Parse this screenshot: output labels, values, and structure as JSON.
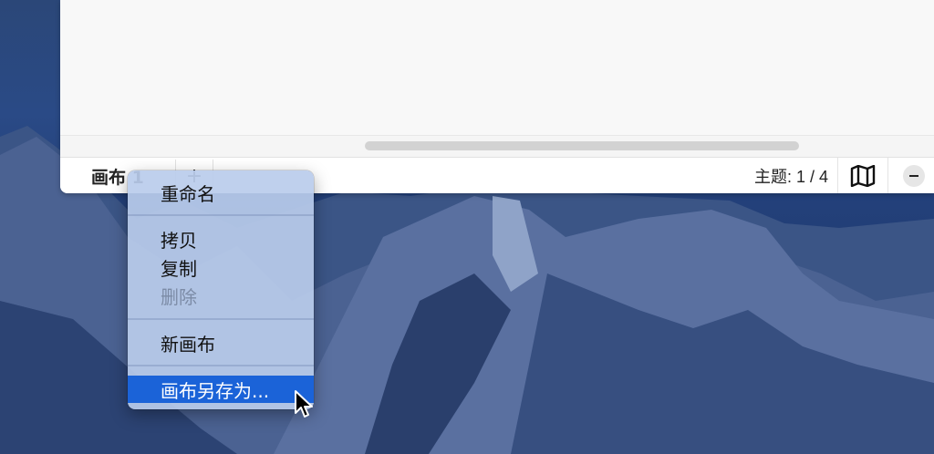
{
  "bottom_bar": {
    "sheet_tab_label": "画布 1",
    "add_sheet_label": "+",
    "topic_count": "主题: 1 / 4"
  },
  "context_menu": {
    "rename": "重命名",
    "copy": "拷贝",
    "duplicate": "复制",
    "delete": "删除",
    "new_sheet": "新画布",
    "save_sheet_as": "画布另存为..."
  },
  "icons": {
    "map": "map-icon",
    "zoom_out": "minus-icon",
    "cursor": "pointer-cursor-icon"
  },
  "colors": {
    "menu_highlight": "#1b63d8"
  }
}
